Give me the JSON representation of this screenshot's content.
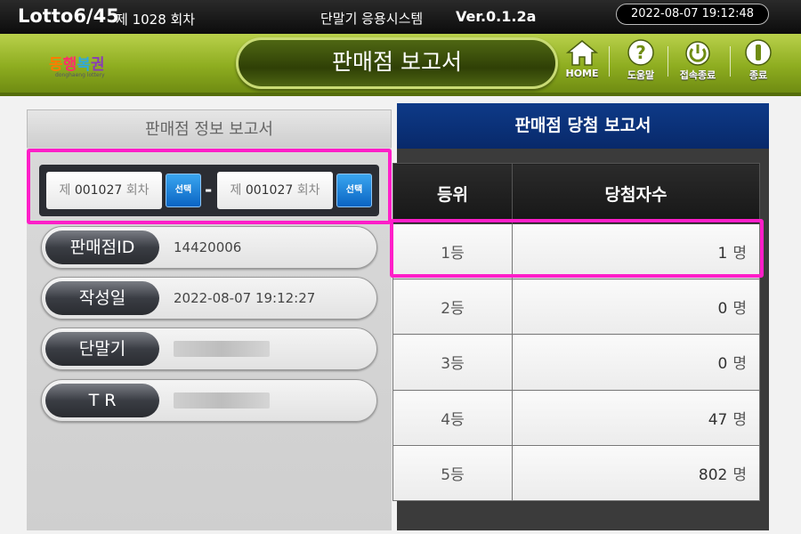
{
  "topbar": {
    "brand": "Lotto6/45",
    "round": "제 1028 회차",
    "system_name": "단말기 응용시스템",
    "version": "Ver.0.1.2a",
    "clock": "2022-08-07   19:12:48"
  },
  "header": {
    "logo_chars": [
      "동",
      "행",
      "복",
      "권"
    ],
    "logo_sub": "donghaeng lottery",
    "title": "판매점 보고서",
    "buttons": [
      {
        "label": "HOME",
        "icon": "home-icon"
      },
      {
        "label": "도움말",
        "icon": "help-icon"
      },
      {
        "label": "접속종료",
        "icon": "power-icon"
      },
      {
        "label": "종료",
        "icon": "exit-icon"
      }
    ]
  },
  "tabs": {
    "info_report": "판매점 정보 보고서",
    "win_report": "판매점 당첨 보고서"
  },
  "range": {
    "from_prefix": "제",
    "from_value": "001027",
    "from_suffix": "회차",
    "to_prefix": "제",
    "to_value": "001027",
    "to_suffix": "회차",
    "select_label": "선택",
    "dash": "-"
  },
  "info": {
    "store_id_label": "판매점ID",
    "store_id_value": "14420006",
    "created_label": "작성일",
    "created_value": "2022-08-07   19:12:27",
    "terminal_label": "단말기",
    "tr_label": "T  R"
  },
  "table": {
    "headers": [
      "등위",
      "당첨자수"
    ],
    "unit": "명",
    "rows": [
      {
        "rank": "1등",
        "count": "1"
      },
      {
        "rank": "2등",
        "count": "0"
      },
      {
        "rank": "3등",
        "count": "0"
      },
      {
        "rank": "4등",
        "count": "47"
      },
      {
        "rank": "5등",
        "count": "802"
      }
    ]
  },
  "colors": {
    "highlight": "#ff1ec8",
    "header_green": "#8ead20",
    "active_tab_blue": "#0e3a88",
    "select_blue": "#0a64c4"
  }
}
